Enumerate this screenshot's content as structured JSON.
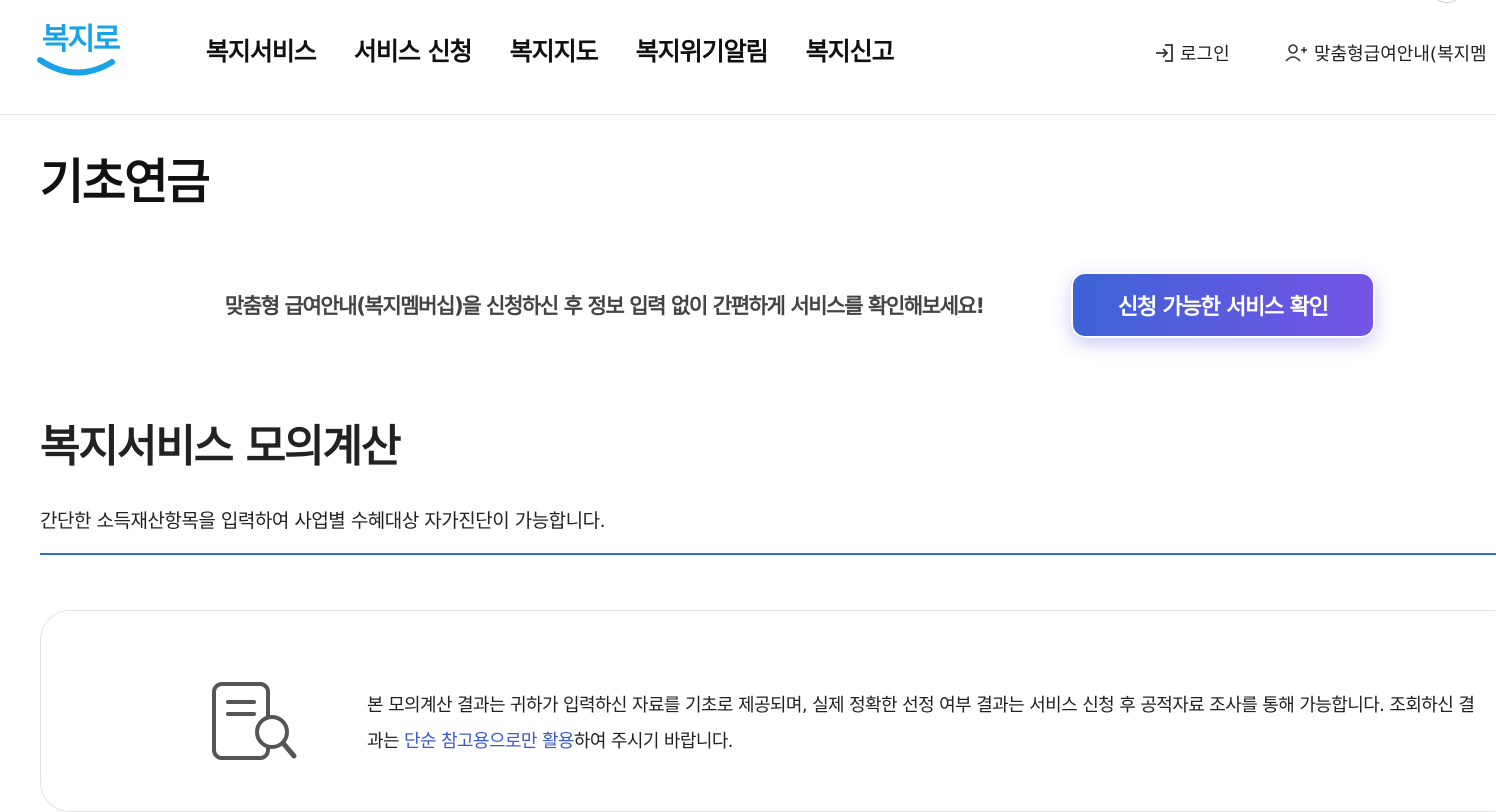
{
  "header": {
    "logo_text": "복지로",
    "nav": [
      "복지서비스",
      "서비스 신청",
      "복지지도",
      "복지위기알림",
      "복지신고"
    ],
    "login_label": "로그인",
    "custom_label": "맞춤형급여안내(복지멤"
  },
  "page": {
    "title": "기초연금"
  },
  "promo": {
    "text": "맞춤형 급여안내(복지멤버십)을 신청하신 후 정보 입력 없이 간편하게 서비스를 확인해보세요!",
    "button_label": "신청 가능한 서비스 확인"
  },
  "simulation": {
    "title": "복지서비스 모의계산",
    "description": "간단한 소득재산항목을 입력하여 사업별 수혜대상 자가진단이 가능합니다."
  },
  "notice": {
    "text_before": "본 모의계산 결과는 귀하가 입력하신 자료를 기초로 제공되며, 실제 정확한 선정 여부 결과는 서비스 신청 후 공적자료 조사를 통해 가능합니다. 조회하신 결과는 ",
    "highlight": "단순 참고용으로만 활용",
    "text_after": "하여 주시기 바랍니다."
  },
  "colors": {
    "logo": "#19a3e6",
    "divider": "#2773c3",
    "button_gradient_start": "#3d63d6",
    "button_gradient_end": "#7553e6",
    "highlight": "#3b5bd6"
  },
  "icons": [
    "login-icon",
    "user-plus-icon",
    "document-search-icon"
  ]
}
